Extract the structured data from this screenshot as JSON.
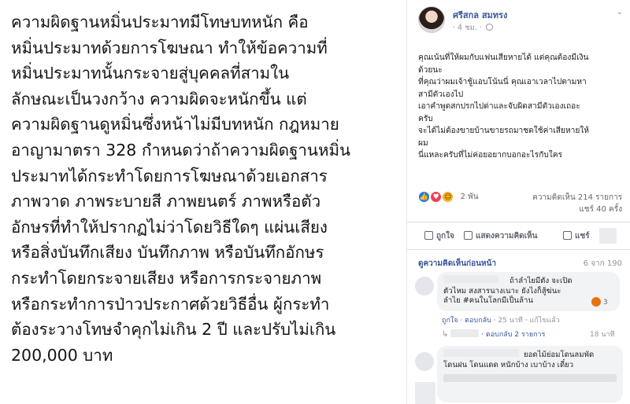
{
  "article": {
    "lines": [
      "ความผิดฐานหมิ่นประมาทมีโทษบทหนัก คือ",
      "หมิ่นประมาทด้วยการโฆษณา ทำให้ข้อความที่",
      "หมิ่นประมาทนั้นกระจายสู่บุคคลที่สามใน",
      "ลักษณะเป็นวงกว้าง ความผิดจะหนักขึ้น แต่",
      "ความผิดฐานดูหมิ่นซึ่งหน้าไม่มีบทหนัก กฎหมาย",
      "อาญามาตรา 328 กำหนดว่าถ้าความผิดฐานหมิ่น",
      "ประมาทได้กระทำโดยการโฆษณาด้วยเอกสาร",
      "ภาพวาด ภาพระบายสี ภาพยนตร์ ภาพหรือตัว",
      "อักษรที่ทำให้ปรากฏไม่ว่าโดยวิธีใดๆ แผ่นเสียง",
      "หรือสิ่งบันทึกเสียง บันทึกภาพ หรือบันทึกอักษร",
      "กระทำโดยกระจายเสียง หรือการกระจายภาพ",
      "หรือกระทำการป่าวประกาศด้วยวิธีอื่น ผู้กระทำ",
      "ต้องระวางโทษจำคุกไม่เกิน 2 ปี และปรับไม่เกิน",
      "200,000 บาท"
    ]
  },
  "post": {
    "author": "ศรีสกล สมทรง",
    "time": "4 ชม.",
    "body_lines": [
      "คุณเน้นที่ให้ผมกับแฟนเสียหายได้ แต่คุณต้องมีเงิน",
      "ด้วยนะ",
      "ที่คุณว่าผมเจ้าชู้แอบโน้นนี่ คุณเอาเวลาไปตามหา",
      "สามีตัวเองไป",
      "เอาคำพูดสกปรกไปด่าและจับผิดสามีตัวเองเถอะ",
      "ครับ",
      "จะได้ไม่ต้องขายบ้านขายรถมาชดใช้ค่าเสียหายให้",
      "ผม",
      "นี่แหละครับที่ไม่ค่อยอยากบอกอะไรกับใคร"
    ],
    "reactions_count": "2 พัน",
    "comments_stat": "ความคิดเห็น 214 รายการ",
    "shares_stat": "แชร์ 40 ครั้ง",
    "actions": {
      "like": "ถูกใจ",
      "comment": "แสดงความคิดเห็น",
      "share": "แชร์"
    },
    "previous_comments": "ดูความคิดเห็นก่อนหน้า",
    "comment_counter": "6 จาก 190"
  },
  "comments": [
    {
      "lines": [
        "ถ้าลำไยมีตัง จะเปิด",
        "ตัวไหม สงสารนางเนาะ ยังไงก็สู้ฆ่นะ",
        "ลำไย #คนในโลกมีเป็นล้าน"
      ],
      "reaction_count": "3",
      "like": "ถูกใจ",
      "reply": "ตอบกลับ",
      "time": "25 นาที",
      "edited": "แก้ไขแล้ว",
      "replies": "ตอบกลับ 2 รายการ",
      "replies_time": "18 นาที"
    },
    {
      "lines": [
        "ยอดไม้ย่อมโดนลมพัด",
        "โดนฝน โดนแดด หนักบ้าง เบาบ้าง เดี๋ยว"
      ]
    }
  ],
  "icons": {
    "globe": "globe-icon",
    "more": "chevron-down-icon",
    "like": "like-icon",
    "comment": "comment-icon",
    "share": "share-icon",
    "angry": "angry-icon",
    "reply": "reply-arrow-icon"
  },
  "colors": {
    "link_blue": "#385898",
    "meta_gray": "#90949c",
    "like_blue": "#1877f2",
    "love_red": "#f33e58",
    "haha_yellow": "#f7b125"
  }
}
